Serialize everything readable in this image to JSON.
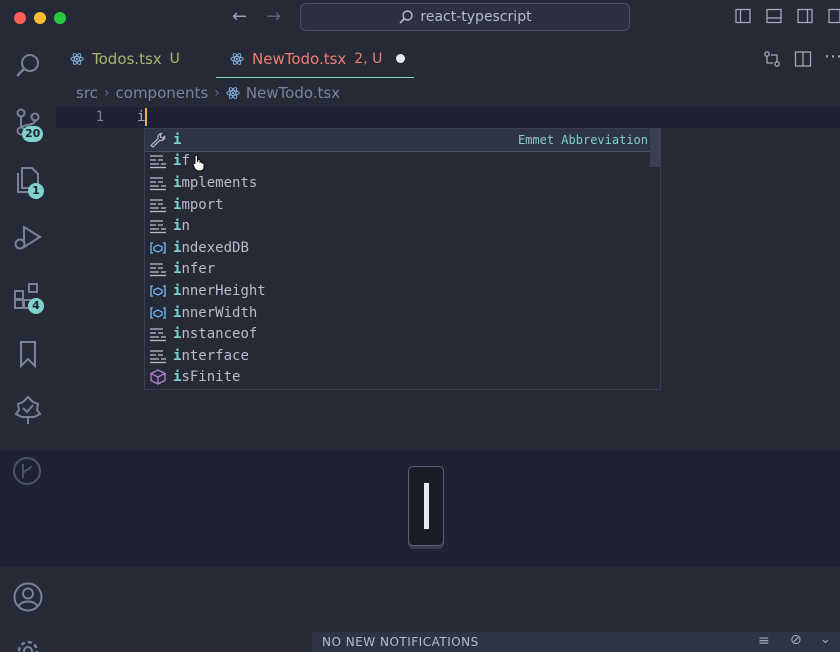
{
  "window": {
    "search_text": "react-typescript"
  },
  "tabs": [
    {
      "label": "Todos.tsx",
      "status": "U"
    },
    {
      "label": "NewTodo.tsx",
      "status": "2, U"
    }
  ],
  "breadcrumb": {
    "part1": "src",
    "part2": "components",
    "part3": "NewTodo.tsx"
  },
  "editor": {
    "line_number": "1",
    "code": "i"
  },
  "activity": {
    "source_control_badge": "20",
    "explorer_badge": "1",
    "extensions_badge": "4"
  },
  "suggest": {
    "items": [
      {
        "first": "i",
        "rest": "",
        "kind": "wrench-icon",
        "detail": "Emmet Abbreviation"
      },
      {
        "first": "i",
        "rest": "f",
        "kind": "keyword-icon"
      },
      {
        "first": "i",
        "rest": "mplements",
        "kind": "keyword-icon"
      },
      {
        "first": "i",
        "rest": "mport",
        "kind": "keyword-icon"
      },
      {
        "first": "i",
        "rest": "n",
        "kind": "keyword-icon"
      },
      {
        "first": "i",
        "rest": "ndexedDB",
        "kind": "variable-icon"
      },
      {
        "first": "i",
        "rest": "nfer",
        "kind": "keyword-icon"
      },
      {
        "first": "i",
        "rest": "nnerHeight",
        "kind": "variable-icon"
      },
      {
        "first": "i",
        "rest": "nnerWidth",
        "kind": "variable-icon"
      },
      {
        "first": "i",
        "rest": "nstanceof",
        "kind": "keyword-icon"
      },
      {
        "first": "i",
        "rest": "nterface",
        "kind": "keyword-icon"
      },
      {
        "first": "i",
        "rest": "sFinite",
        "kind": "method-icon"
      }
    ]
  },
  "notifications": {
    "text": "NO NEW NOTIFICATIONS"
  },
  "colors": {
    "accent": "#7fd3c9",
    "modified": "#f07e6e",
    "untracked": "#a8b76b",
    "caret": "#e6b64a"
  }
}
